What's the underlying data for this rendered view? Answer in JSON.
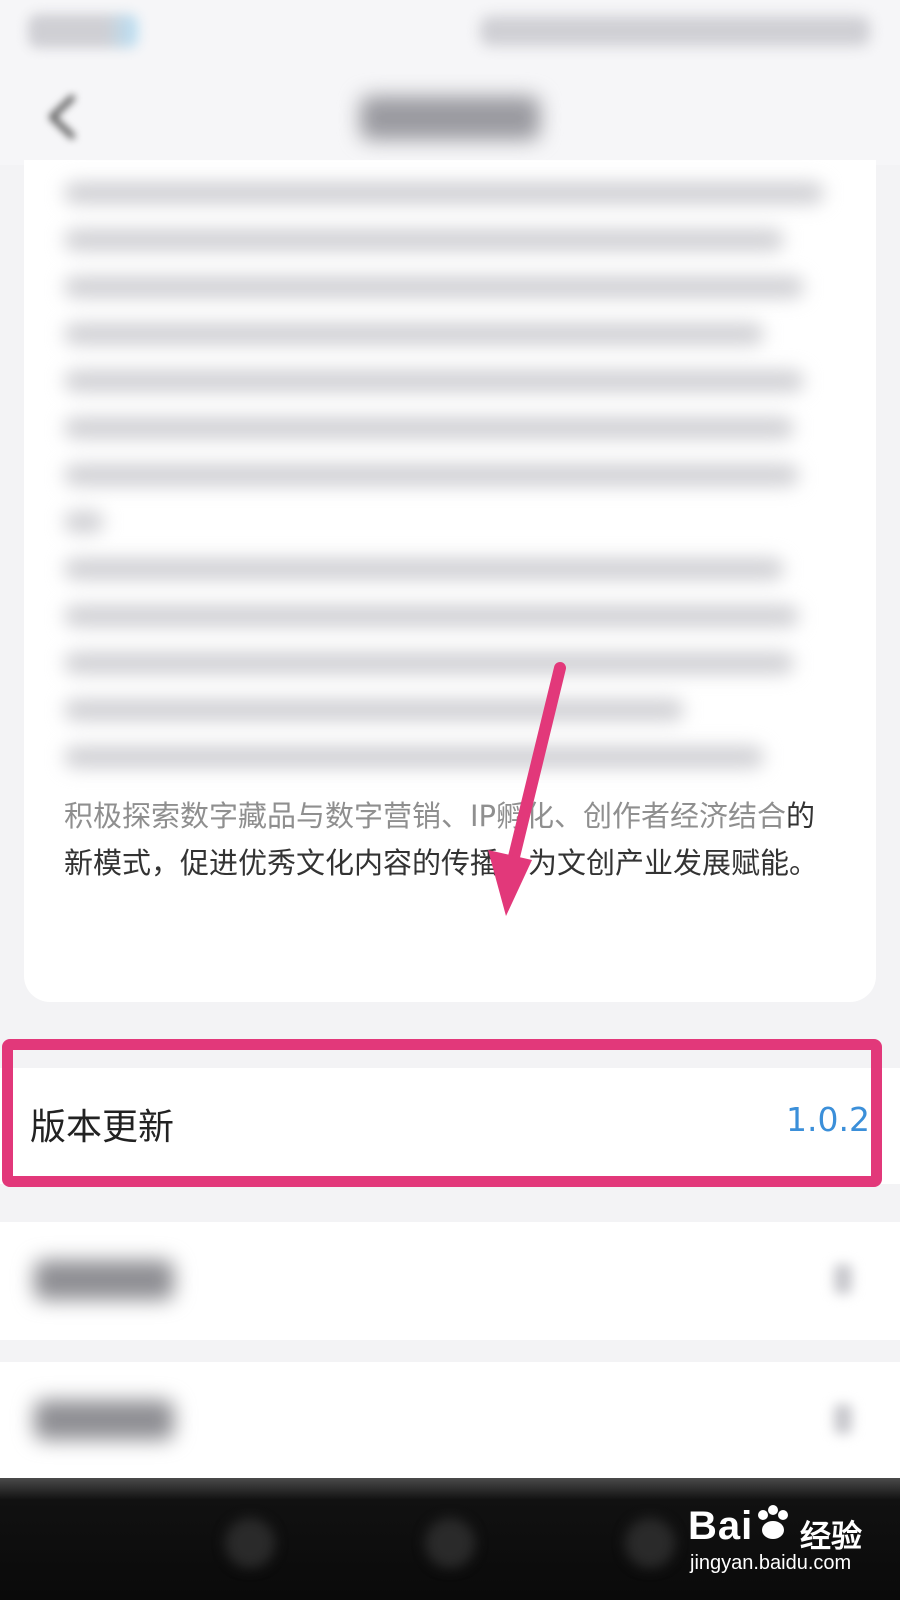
{
  "about": {
    "description_faded": "积极探索数字藏品与数字营销、IP孵化、创作者经济结合",
    "description": "的新模式，促进优秀文化内容的传播，为文创产业发展赋能。"
  },
  "version_row": {
    "label": "版本更新",
    "value": "1.0.2"
  },
  "colors": {
    "highlight": "#e2387a",
    "version_value": "#3b8fd9"
  },
  "watermark": {
    "logo_text": "Bai",
    "logo_suffix": "du",
    "cn_text": "经验",
    "url": "jingyan.baidu.com"
  }
}
